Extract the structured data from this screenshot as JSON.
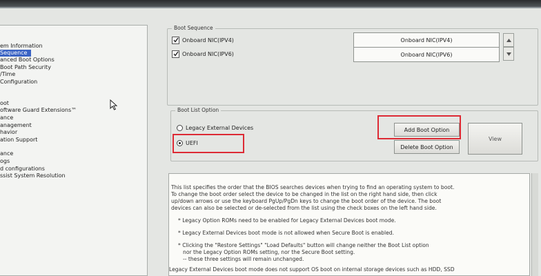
{
  "sidebar": {
    "items": [
      {
        "label": "em Information",
        "selected": false
      },
      {
        "label": "Sequence",
        "selected": true
      },
      {
        "label": "anced Boot Options",
        "selected": false
      },
      {
        "label": "Boot Path Security",
        "selected": false
      },
      {
        "label": "/Time",
        "selected": false
      },
      {
        "label": "Configuration",
        "selected": false
      },
      {
        "label": "oot",
        "selected": false
      },
      {
        "label": "oftware Guard Extensions™",
        "selected": false
      },
      {
        "label": "ance",
        "selected": false
      },
      {
        "label": "anagement",
        "selected": false
      },
      {
        "label": "havior",
        "selected": false
      },
      {
        "label": "ation Support",
        "selected": false
      },
      {
        "label": "ance",
        "selected": false
      },
      {
        "label": "ogs",
        "selected": false
      },
      {
        "label": "d configurations",
        "selected": false
      },
      {
        "label": "ssist System Resolution",
        "selected": false
      }
    ]
  },
  "boot_sequence": {
    "legend": "Boot Sequence",
    "entries": [
      {
        "label": "Onboard NIC(IPV4)",
        "checked": true,
        "field_value": "Onboard NIC(IPV4)"
      },
      {
        "label": "Onboard NIC(IPV6)",
        "checked": true,
        "field_value": "Onboard NIC(IPV6)"
      }
    ],
    "scroll_up_icon": "arrow-up",
    "scroll_down_icon": "arrow-down"
  },
  "boot_list_option": {
    "legend": "Boot List Option",
    "options": [
      {
        "label": "Legacy External Devices",
        "selected": false
      },
      {
        "label": "UEFI",
        "selected": true
      }
    ],
    "buttons": {
      "add": "Add Boot Option",
      "delete": "Delete Boot Option",
      "view": "View"
    }
  },
  "help_text": {
    "lines": [
      "This list specifies the order that the BIOS searches devices when trying to find an operating system to boot.",
      "To change the boot order select the device to be changed in the list on the right hand side, then click",
      "up/down arrows or use the keyboard PgUp/PgDn keys to change the boot order of the device. The boot",
      "devices can also be selected or de-selected from the list using the check boxes on the left hand side.",
      "* Legacy Option ROMs need to be enabled for Legacy External Devices boot mode.",
      "* Legacy External Devices boot mode is not allowed when Secure Boot is enabled.",
      "* Clicking the \"Restore Settings\" \"Load Defaults\" button will change neither the Boot List option",
      "nor the Legacy Option ROMs setting, nor the Secure Boot setting.",
      "-- these three settings will remain unchanged.",
      "Legacy External Devices boot mode does not support OS boot on internal storage devices such as HDD, SSD"
    ]
  },
  "colors": {
    "highlight": "#dd2a34",
    "selection": "#3a63c4",
    "background": "#e4e6e3"
  }
}
